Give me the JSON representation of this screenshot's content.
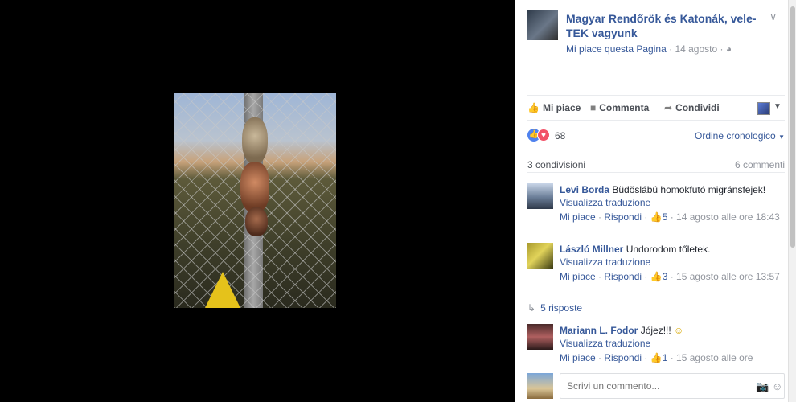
{
  "post": {
    "page_name": "Magyar Rendőrök és Katonák, vele-TEK vagyunk",
    "like_page": "Mi piace questa Pagina",
    "date": "14 agosto",
    "separator": "·"
  },
  "actions": {
    "like": "Mi piace",
    "comment": "Commenta",
    "share": "Condividi"
  },
  "reactions": {
    "count": "68",
    "order": "Ordine cronologico"
  },
  "counts": {
    "shares": "3 condivisioni",
    "comments": "6 commenti"
  },
  "comments": [
    {
      "author": "Levi Borda",
      "text": "Büdöslábú homokfutó migránsfejek!",
      "translate": "Visualizza traduzione",
      "like": "Mi piace",
      "reply": "Rispondi",
      "likes": "5",
      "time": "14 agosto alle ore 18:43"
    },
    {
      "author": "László Millner",
      "text": "Undorodom tőletek.",
      "translate": "Visualizza traduzione",
      "like": "Mi piace",
      "reply": "Rispondi",
      "likes": "3",
      "time": "15 agosto alle ore 13:57"
    },
    {
      "author": "Mariann L. Fodor",
      "text": "Jójez!!!",
      "translate": "Visualizza traduzione",
      "like": "Mi piace",
      "reply": "Rispondi",
      "likes": "1",
      "time": "15 agosto alle ore"
    }
  ],
  "replies": "5 risposte",
  "write": {
    "placeholder": "Scrivi un commento..."
  },
  "icons": {
    "globe": "globe-icon",
    "chevron": "chevron-down-icon",
    "camera": "camera-icon",
    "smiley": "smiley-icon"
  },
  "colors": {
    "link": "#365899",
    "like_reaction": "#4f82ee",
    "love_reaction": "#f25268"
  }
}
